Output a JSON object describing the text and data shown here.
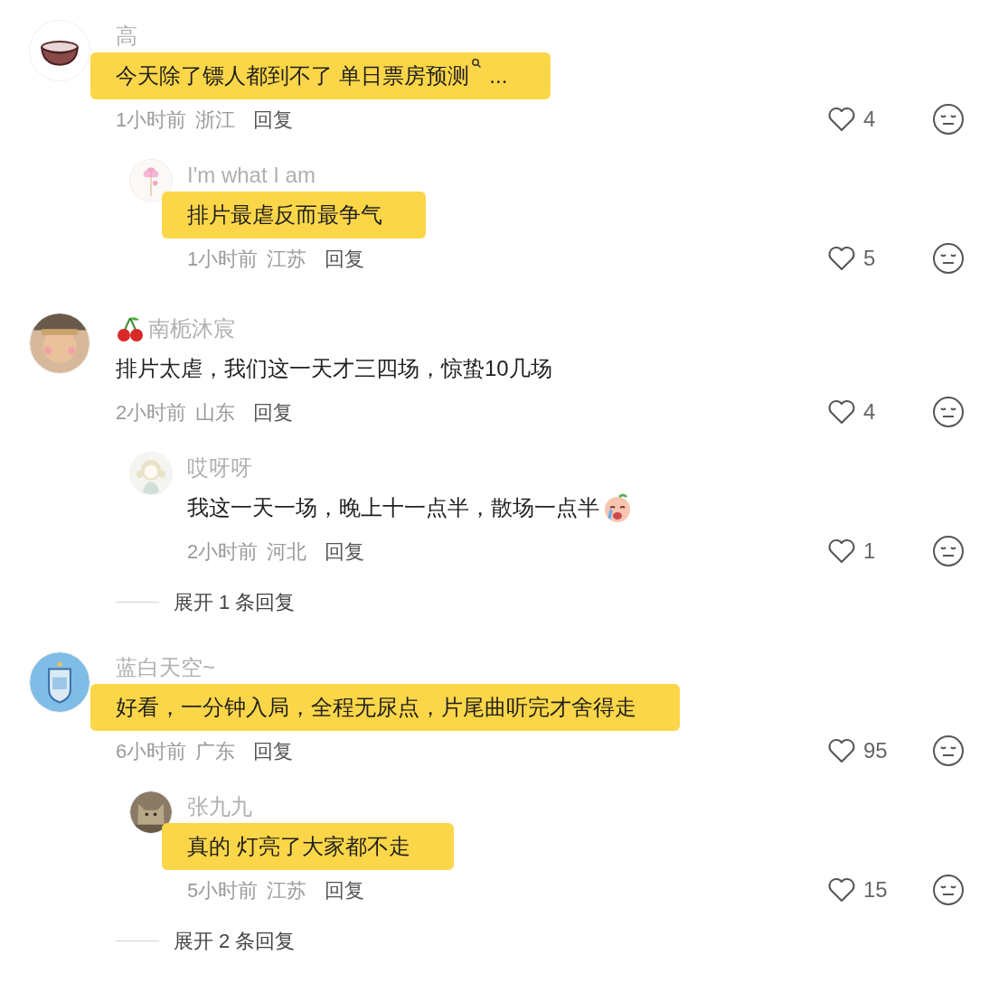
{
  "threads": [
    {
      "comment": {
        "avatar": {
          "kind": "bowl"
        },
        "name": "高",
        "body": [
          {
            "kind": "text",
            "text": "今天除了镖人都到不了 单日票房预测"
          },
          {
            "kind": "search"
          },
          {
            "kind": "text",
            "text": " ..."
          }
        ],
        "highlighted": true,
        "time": "1小时前",
        "region": "浙江",
        "reply": "回复",
        "likes": "4"
      },
      "replies": [
        {
          "avatar": {
            "kind": "lotus"
          },
          "name": "I'm what I am",
          "body": [
            {
              "kind": "text",
              "text": "排片最虐反而最争气"
            }
          ],
          "highlighted": true,
          "time": "1小时前",
          "region": "江苏",
          "reply": "回复",
          "likes": "5"
        }
      ]
    },
    {
      "comment": {
        "avatar": {
          "kind": "figure"
        },
        "name_icon": {
          "kind": "cherry"
        },
        "name": "南栀沐宸",
        "body": [
          {
            "kind": "text",
            "text": "排片太虐，我们这一天才三四场，惊蛰10几场"
          }
        ],
        "highlighted": false,
        "time": "2小时前",
        "region": "山东",
        "reply": "回复",
        "likes": "4"
      },
      "replies": [
        {
          "avatar": {
            "kind": "girl"
          },
          "name": "哎呀呀",
          "body": [
            {
              "kind": "text",
              "text": "我这一天一场，晚上十一点半，散场一点半"
            },
            {
              "kind": "crying"
            }
          ],
          "highlighted": false,
          "time": "2小时前",
          "region": "河北",
          "reply": "回复",
          "likes": "1"
        }
      ],
      "expand": "展开 1 条回复"
    },
    {
      "comment": {
        "avatar": {
          "kind": "emblem"
        },
        "name": "蓝白天空~",
        "body": [
          {
            "kind": "text",
            "text": "好看，一分钟入局，全程无尿点，片尾曲听完才舍得走"
          }
        ],
        "highlighted": true,
        "time": "6小时前",
        "region": "广东",
        "reply": "回复",
        "likes": "95"
      },
      "replies": [
        {
          "avatar": {
            "kind": "cat"
          },
          "name": "张九九",
          "body": [
            {
              "kind": "text",
              "text": "真的 灯亮了大家都不走"
            }
          ],
          "highlighted": true,
          "time": "5小时前",
          "region": "江苏",
          "reply": "回复",
          "likes": "15"
        }
      ],
      "expand": "展开 2 条回复"
    }
  ]
}
